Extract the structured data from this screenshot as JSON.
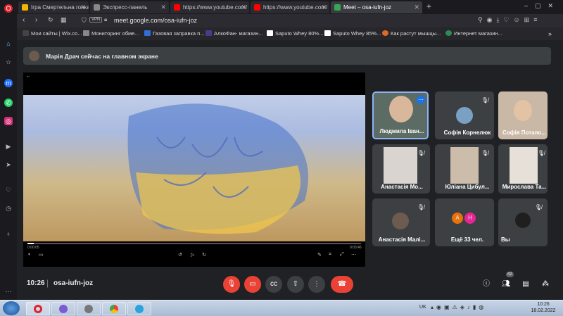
{
  "tabs": [
    {
      "title": "Ігра Смертельна гонка он",
      "color": "#f4b400"
    },
    {
      "title": "Экспресс-панель",
      "color": "#888888"
    },
    {
      "title": "https://www.youtube.com/",
      "color": "#ff0000"
    },
    {
      "title": "https://www.youtube.com/",
      "color": "#ff0000"
    },
    {
      "title": "Meet – osa-iufn-joz",
      "color": "#34a853"
    }
  ],
  "address": {
    "vpn": "VPN",
    "url": "meet.google.com/osa-iufn-joz"
  },
  "bookmarks": [
    {
      "label": "Мои сайты | Wix.co...",
      "color": "#444444"
    },
    {
      "label": "Мониторинг обме...",
      "color": "#888888"
    },
    {
      "label": "Газовая заправка п...",
      "color": "#2f6fd6"
    },
    {
      "label": "АлкоФан- магазин...",
      "color": "#4a3a8a"
    },
    {
      "label": "Saputo Whey 80%...",
      "color": "#ffffff"
    },
    {
      "label": "Saputo Whey 85%...",
      "color": "#ffffff"
    },
    {
      "label": "Как растут мышцы...",
      "color": "#e0692a"
    },
    {
      "label": "Интернет магазин...",
      "color": "#2e8b57"
    }
  ],
  "meet": {
    "notification": "Марія Драч сейчас на главном экране",
    "time": "10:26",
    "meeting_code": "osa-iufn-joz",
    "video": {
      "time_left": "0:00:05",
      "time_right": "0:03:46"
    },
    "participants": [
      {
        "name": "Людмила Іван...",
        "speaking": true
      },
      {
        "name": "Софія Корнелюк",
        "speaking": false
      },
      {
        "name": "Софія Потапо...",
        "speaking": false
      },
      {
        "name": "Анастасія Мо...",
        "speaking": false
      },
      {
        "name": "Юліана Цибул...",
        "speaking": false
      },
      {
        "name": "Мирослава Та...",
        "speaking": false
      },
      {
        "name": "Анастасія Малі...",
        "speaking": false
      },
      {
        "name": "Ещё 33 чел.",
        "speaking": false,
        "initials": [
          "А",
          "Н"
        ]
      },
      {
        "name": "Вы",
        "speaking": false
      }
    ],
    "people_count": "42"
  },
  "taskbar": {
    "lang": "UK",
    "clock_time": "10:26",
    "clock_date": "18.02.2022"
  }
}
